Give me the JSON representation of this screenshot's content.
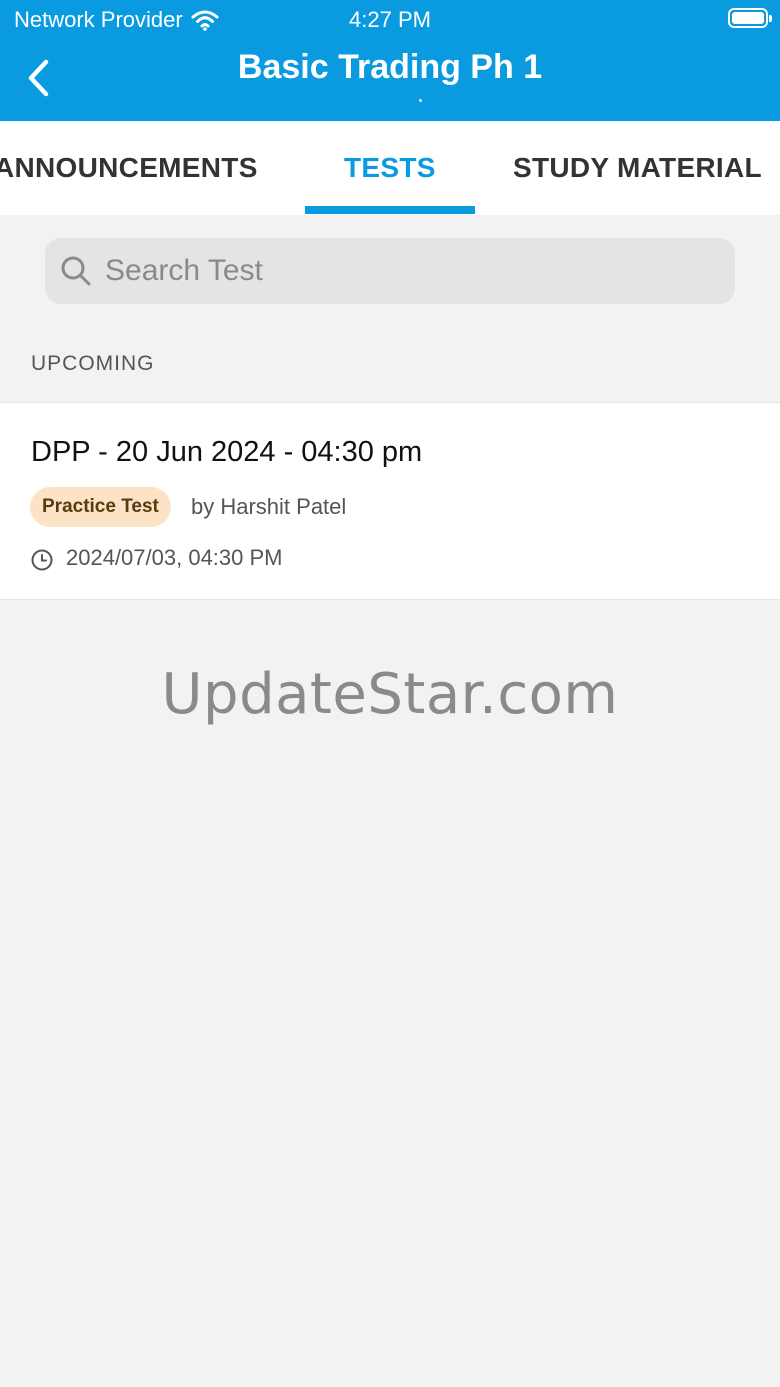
{
  "status_bar": {
    "carrier": "Network Provider",
    "time": "4:27 PM",
    "wifi_icon": "wifi-icon",
    "battery_icon": "battery-icon"
  },
  "header": {
    "title": "Basic Trading Ph 1",
    "back_icon": "chevron-left-icon",
    "background_color": "#0a9ae0"
  },
  "tabs": [
    {
      "label": "ANNOUNCEMENTS",
      "active": false
    },
    {
      "label": "TESTS",
      "active": true
    },
    {
      "label": "STUDY MATERIAL",
      "active": false
    }
  ],
  "search": {
    "placeholder": "Search Test",
    "value": ""
  },
  "sections": [
    {
      "label": "UPCOMING",
      "items": [
        {
          "title": "DPP - 20 Jun 2024 - 04:30 pm",
          "badge": "Practice Test",
          "author": "by Harshit Patel",
          "datetime": "2024/07/03, 04:30 PM"
        }
      ]
    }
  ],
  "watermark": "UpdateStar.com"
}
